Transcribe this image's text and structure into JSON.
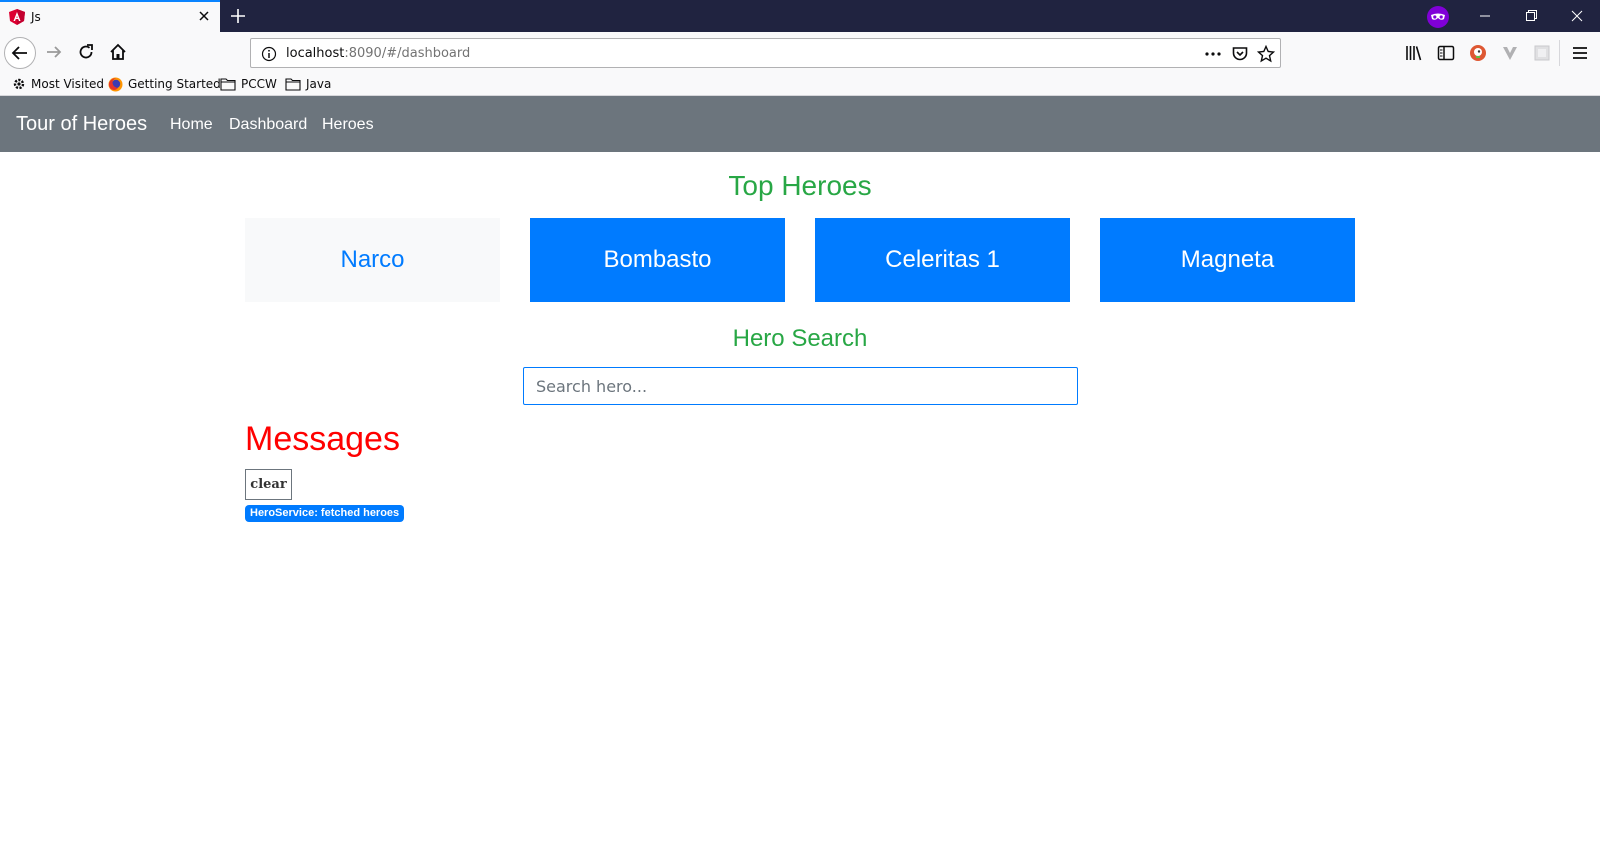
{
  "browser": {
    "tab_title": "Js",
    "url_host": "localhost",
    "url_rest": ":8090/#/dashboard",
    "bookmarks": [
      "Most Visited",
      "Getting Started",
      "PCCW",
      "Java"
    ]
  },
  "app": {
    "brand": "Tour of Heroes",
    "nav_links": [
      "Home",
      "Dashboard",
      "Heroes"
    ],
    "top_heroes_title": "Top Heroes",
    "heroes": [
      {
        "name": "Narco",
        "style": "light"
      },
      {
        "name": "Bombasto",
        "style": "primary"
      },
      {
        "name": "Celeritas 1",
        "style": "primary"
      },
      {
        "name": "Magneta",
        "style": "primary"
      }
    ],
    "search_title": "Hero Search",
    "search_placeholder": "Search hero...",
    "messages_title": "Messages",
    "clear_label": "clear",
    "messages": [
      "HeroService: fetched heroes"
    ]
  },
  "colors": {
    "nav_bg": "#6c757d",
    "primary": "#007bff",
    "success": "#28a745",
    "messages_red": "#ff0000",
    "titlebar": "#202340"
  },
  "icons": {
    "tab_favicon": "angular-icon",
    "private_browsing": "private-mask-icon"
  }
}
